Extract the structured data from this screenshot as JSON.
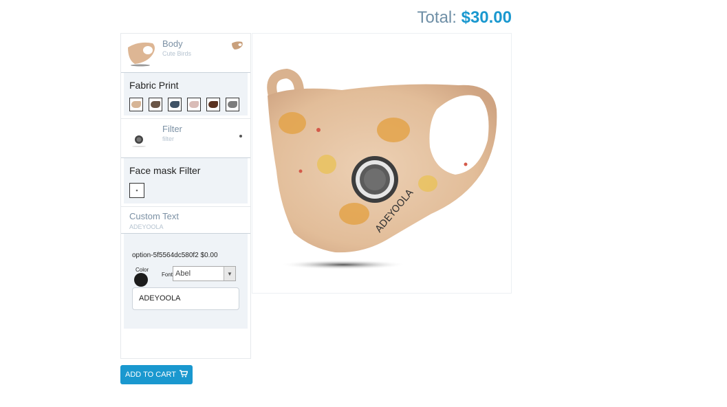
{
  "total": {
    "label": "Total:",
    "amount": "$30.00"
  },
  "layers": [
    {
      "title": "Body",
      "subtitle": "Cute Birds"
    },
    {
      "title": "Filter",
      "subtitle": "filter"
    }
  ],
  "fabric_print": {
    "title": "Fabric Print",
    "swatch_colors": [
      "#d7b596",
      "#6a5546",
      "#3f5266",
      "#d9bcb7",
      "#5b3321",
      "#7d7d7d"
    ]
  },
  "face_mask_filter": {
    "title": "Face mask Filter"
  },
  "custom_text": {
    "title": "Custom Text",
    "subtitle": "ADEYOOLA",
    "option_label": "option-5f5564dc580f2 $0.00",
    "color_label": "Color",
    "color_value": "#1c1c1c",
    "font_label": "Font",
    "font_value": "Abel",
    "text_value": "ADEYOOLA"
  },
  "mask_print_text": "ADEYOOLA",
  "add_to_cart": {
    "label": "ADD TO CART",
    "icon": "cart-icon"
  },
  "colors": {
    "accent": "#1a98cf",
    "panel_bg": "#eff3f7",
    "mask_fabric": "#e7c2a0"
  }
}
